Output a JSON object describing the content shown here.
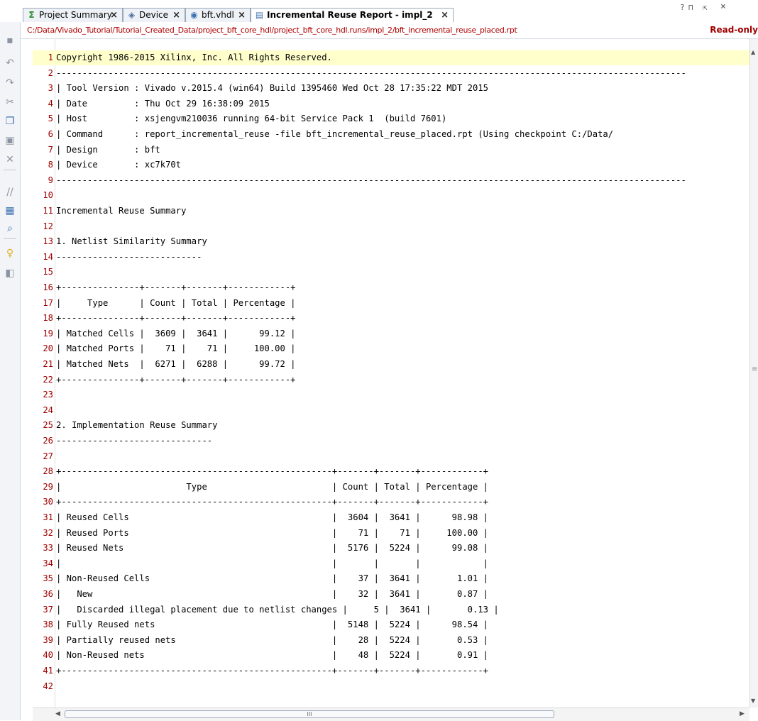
{
  "tabs": [
    {
      "label": "Project Summary",
      "icon": "sigma-icon",
      "glyph": "Σ"
    },
    {
      "label": "Device",
      "icon": "device-icon",
      "glyph": "◈"
    },
    {
      "label": "bft.vhdl",
      "icon": "vhdl-file-icon",
      "glyph": "◉"
    },
    {
      "label": "Incremental Reuse Report - impl_2",
      "icon": "report-icon",
      "glyph": "▤",
      "active": true
    }
  ],
  "window_controls": {
    "help": "?",
    "float": "⊓",
    "maximize": "⇱",
    "close": "×"
  },
  "path": "C:/Data/Vivado_Tutorial/Tutorial_Created_Data/project_bft_core_hdl/project_bft_core_hdl.runs/impl_2/bft_incremental_reuse_placed.rpt",
  "readonly_label": "Read-only",
  "toolbar_icons": [
    "save-icon",
    "undo-icon",
    "redo-icon",
    "cut-icon",
    "copy-icon",
    "paste-icon",
    "delete-icon",
    "comment-icon",
    "column-select-icon",
    "find-icon",
    "hint-bulb-icon",
    "insert-template-icon"
  ],
  "lines": [
    {
      "n": "1",
      "text": "Copyright 1986-2015 Xilinx, Inc. All Rights Reserved."
    },
    {
      "n": "2",
      "text": "-------------------------------------------------------------------------------------------------------------------------"
    },
    {
      "n": "3",
      "text": "| Tool Version : Vivado v.2015.4 (win64) Build 1395460 Wed Oct 28 17:35:22 MDT 2015"
    },
    {
      "n": "4",
      "text": "| Date         : Thu Oct 29 16:38:09 2015"
    },
    {
      "n": "5",
      "text": "| Host         : xsjengvm210036 running 64-bit Service Pack 1  (build 7601)"
    },
    {
      "n": "6",
      "text": "| Command      : report_incremental_reuse -file bft_incremental_reuse_placed.rpt (Using checkpoint C:/Data/"
    },
    {
      "n": "7",
      "text": "| Design       : bft"
    },
    {
      "n": "8",
      "text": "| Device       : xc7k70t"
    },
    {
      "n": "9",
      "text": "-------------------------------------------------------------------------------------------------------------------------"
    },
    {
      "n": "10",
      "text": ""
    },
    {
      "n": "11",
      "text": "Incremental Reuse Summary"
    },
    {
      "n": "12",
      "text": ""
    },
    {
      "n": "13",
      "text": "1. Netlist Similarity Summary"
    },
    {
      "n": "14",
      "text": "----------------------------"
    },
    {
      "n": "15",
      "text": ""
    },
    {
      "n": "16",
      "text": "+---------------+-------+-------+------------+"
    },
    {
      "n": "17",
      "text": "|     Type      | Count | Total | Percentage |"
    },
    {
      "n": "18",
      "text": "+---------------+-------+-------+------------+"
    },
    {
      "n": "19",
      "text": "| Matched Cells |  3609 |  3641 |      99.12 |"
    },
    {
      "n": "20",
      "text": "| Matched Ports |    71 |    71 |     100.00 |"
    },
    {
      "n": "21",
      "text": "| Matched Nets  |  6271 |  6288 |      99.72 |"
    },
    {
      "n": "22",
      "text": "+---------------+-------+-------+------------+"
    },
    {
      "n": "23",
      "text": ""
    },
    {
      "n": "24",
      "text": ""
    },
    {
      "n": "25",
      "text": "2. Implementation Reuse Summary"
    },
    {
      "n": "26",
      "text": "------------------------------"
    },
    {
      "n": "27",
      "text": ""
    },
    {
      "n": "28",
      "text": "+----------------------------------------------------+-------+-------+------------+"
    },
    {
      "n": "29",
      "text": "|                        Type                        | Count | Total | Percentage |"
    },
    {
      "n": "30",
      "text": "+----------------------------------------------------+-------+-------+------------+"
    },
    {
      "n": "31",
      "text": "| Reused Cells                                       |  3604 |  3641 |      98.98 |"
    },
    {
      "n": "32",
      "text": "| Reused Ports                                       |    71 |    71 |     100.00 |"
    },
    {
      "n": "33",
      "text": "| Reused Nets                                        |  5176 |  5224 |      99.08 |"
    },
    {
      "n": "34",
      "text": "|                                                    |       |       |            |"
    },
    {
      "n": "35",
      "text": "| Non-Reused Cells                                   |    37 |  3641 |       1.01 |"
    },
    {
      "n": "36",
      "text": "|   New                                              |    32 |  3641 |       0.87 |"
    },
    {
      "n": "37",
      "text": "|   Discarded illegal placement due to netlist changes |     5 |  3641 |       0.13 |"
    },
    {
      "n": "38",
      "text": "| Fully Reused nets                                  |  5148 |  5224 |      98.54 |"
    },
    {
      "n": "39",
      "text": "| Partially reused nets                              |    28 |  5224 |       0.53 |"
    },
    {
      "n": "40",
      "text": "| Non-Reused nets                                    |    48 |  5224 |       0.91 |"
    },
    {
      "n": "41",
      "text": "+----------------------------------------------------+-------+-------+------------+"
    },
    {
      "n": "42",
      "text": ""
    }
  ],
  "scrollbar_grip": "III",
  "colors": {
    "line_number": "#a00000",
    "highlight": "#ffffcc",
    "path": "#b00000"
  }
}
